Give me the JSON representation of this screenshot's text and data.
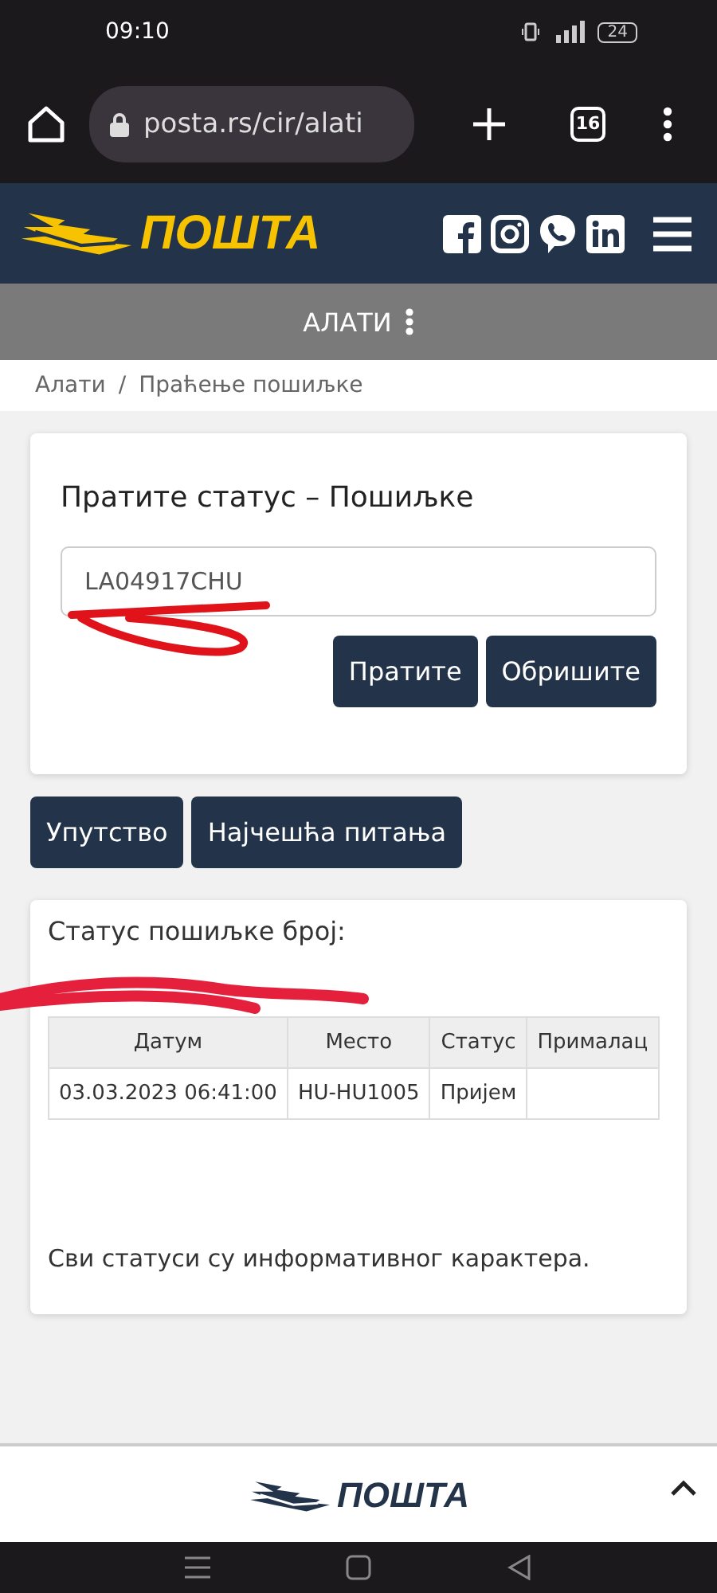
{
  "status_bar": {
    "time": "09:10",
    "battery": "24"
  },
  "browser": {
    "url": "posta.rs/cir/alati",
    "tab_count": "16"
  },
  "header": {
    "logo_text": "ПОШТА"
  },
  "section_bar": {
    "title": "АЛАТИ"
  },
  "breadcrumb": [
    "Алати",
    "/",
    "Праћење пошиљке"
  ],
  "tracking_card": {
    "title": "Пратите статус – Пошиљке",
    "tracking_number": "LA04917CHU",
    "buttons": [
      "Пратите",
      "Обришите"
    ]
  },
  "help_buttons": [
    "Упутство",
    "Најчешћа питања"
  ],
  "result_card": {
    "heading": "Статус пошиљке број:",
    "table": {
      "columns": [
        "Датум",
        "Место",
        "Статус",
        "Прималац"
      ],
      "rows": [
        [
          "03.03.2023 06:41:00",
          "HU-HU1005",
          "Пријем",
          ""
        ]
      ]
    },
    "note": "Сви статуси су информативног карактера."
  },
  "footer": {
    "logo_text": "ПОШТА"
  }
}
